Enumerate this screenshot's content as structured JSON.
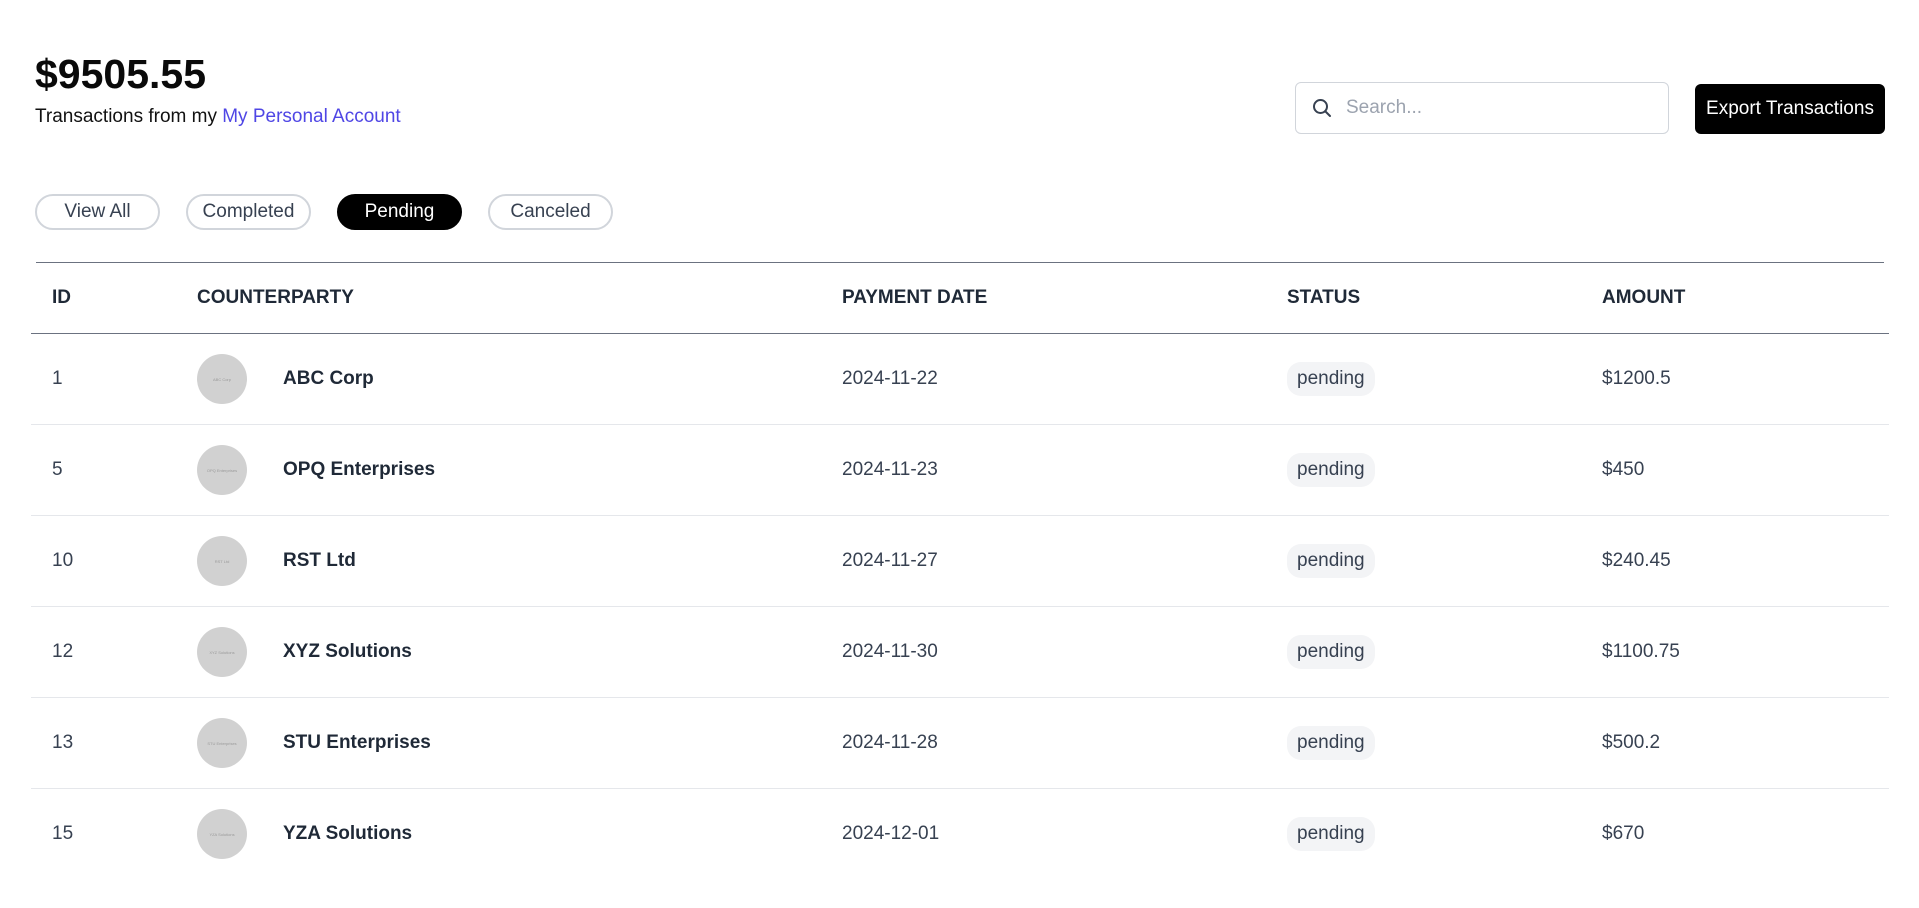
{
  "header": {
    "balance": "$9505.55",
    "subtitle_prefix": "Transactions from my",
    "account_link": "My Personal Account"
  },
  "search": {
    "placeholder": "Search..."
  },
  "export_label": "Export Transactions",
  "filters": [
    {
      "label": "View All",
      "active": false
    },
    {
      "label": "Completed",
      "active": false
    },
    {
      "label": "Pending",
      "active": true
    },
    {
      "label": "Canceled",
      "active": false
    }
  ],
  "table": {
    "columns": [
      "ID",
      "COUNTERPARTY",
      "PAYMENT DATE",
      "STATUS",
      "AMOUNT"
    ],
    "rows": [
      {
        "id": "1",
        "counterparty": "ABC Corp",
        "date": "2024-11-22",
        "status": "pending",
        "amount": "$1200.5"
      },
      {
        "id": "5",
        "counterparty": "OPQ Enterprises",
        "date": "2024-11-23",
        "status": "pending",
        "amount": "$450"
      },
      {
        "id": "10",
        "counterparty": "RST Ltd",
        "date": "2024-11-27",
        "status": "pending",
        "amount": "$240.45"
      },
      {
        "id": "12",
        "counterparty": "XYZ Solutions",
        "date": "2024-11-30",
        "status": "pending",
        "amount": "$1100.75"
      },
      {
        "id": "13",
        "counterparty": "STU Enterprises",
        "date": "2024-11-28",
        "status": "pending",
        "amount": "$500.2"
      },
      {
        "id": "15",
        "counterparty": "YZA Solutions",
        "date": "2024-12-01",
        "status": "pending",
        "amount": "$670"
      }
    ]
  },
  "colors": {
    "link": "#4f46e5",
    "primary": "#000000",
    "badge_bg": "#f3f4f6",
    "avatar_bg": "#d1d1d1"
  },
  "icons": {
    "search": "search-icon"
  }
}
